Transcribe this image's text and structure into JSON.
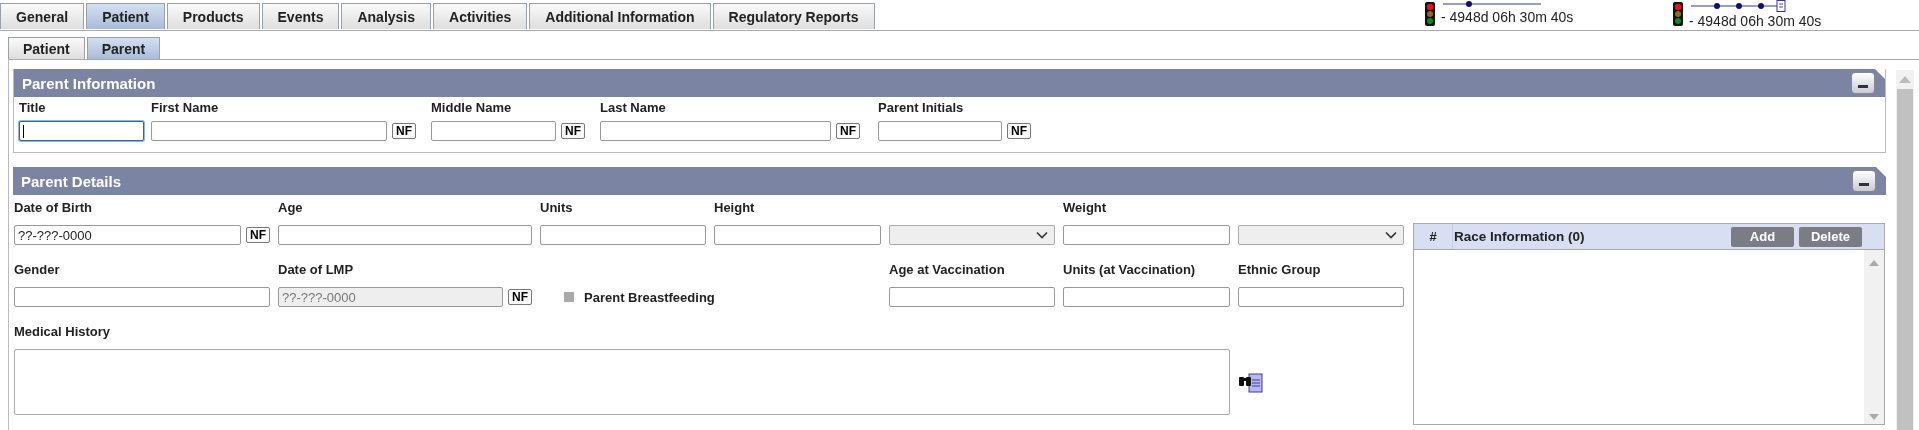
{
  "tabs": [
    {
      "label": "General",
      "selected": false
    },
    {
      "label": "Patient",
      "selected": true
    },
    {
      "label": "Products",
      "selected": false
    },
    {
      "label": "Events",
      "selected": false
    },
    {
      "label": "Analysis",
      "selected": false
    },
    {
      "label": "Activities",
      "selected": false
    },
    {
      "label": "Additional Information",
      "selected": false
    },
    {
      "label": "Regulatory Reports",
      "selected": false
    }
  ],
  "timers": [
    {
      "kind": "single",
      "text": "- 4948d 06h 30m 40s"
    },
    {
      "kind": "steps",
      "text": "- 4948d 06h 30m 40s"
    }
  ],
  "subtabs": [
    {
      "label": "Patient",
      "selected": false
    },
    {
      "label": "Parent",
      "selected": true
    }
  ],
  "parent_information": {
    "title": "Parent Information",
    "fields": [
      {
        "label": "Title",
        "focused": true
      },
      {
        "label": "First Name",
        "focused": false,
        "nf": "NF"
      },
      {
        "label": "Middle Name",
        "focused": false,
        "nf": "NF"
      },
      {
        "label": "Last Name",
        "focused": false,
        "nf": "NF"
      },
      {
        "label": "Parent Initials",
        "focused": false,
        "nf": "NF"
      }
    ]
  },
  "parent_details": {
    "title": "Parent Details",
    "fields": [
      {
        "kind": "text",
        "label": "Date of Birth",
        "value": "??-???-0000",
        "disabled": false,
        "nf": "NF"
      },
      {
        "kind": "text",
        "label": "Age",
        "disabled": false
      },
      {
        "kind": "text",
        "label": "Units",
        "disabled": false
      },
      {
        "kind": "text",
        "label": "Height",
        "disabled": false
      },
      {
        "kind": "select",
        "disabled": true
      },
      {
        "kind": "text",
        "label": "Weight",
        "disabled": false
      },
      {
        "kind": "select",
        "disabled": true
      },
      {
        "kind": "text",
        "label": "Gender",
        "disabled": false
      },
      {
        "kind": "text",
        "label": "Date of LMP",
        "value": "??-???-0000",
        "disabled": true,
        "nf": "NF"
      },
      {
        "kind": "checkbox",
        "label": "Parent Breastfeeding",
        "checked": false
      },
      {
        "kind": "text",
        "label": "Age at Vaccination",
        "disabled": false
      },
      {
        "kind": "text",
        "label": "Units (at Vaccination)",
        "disabled": false
      },
      {
        "kind": "text",
        "label": "Ethnic Group",
        "disabled": false
      },
      {
        "kind": "textarea",
        "label": "Medical History",
        "disabled": false
      }
    ],
    "race_table": {
      "columns": [
        "#",
        "Race Information (0)"
      ],
      "buttons": [
        "Add",
        "Delete"
      ]
    }
  }
}
